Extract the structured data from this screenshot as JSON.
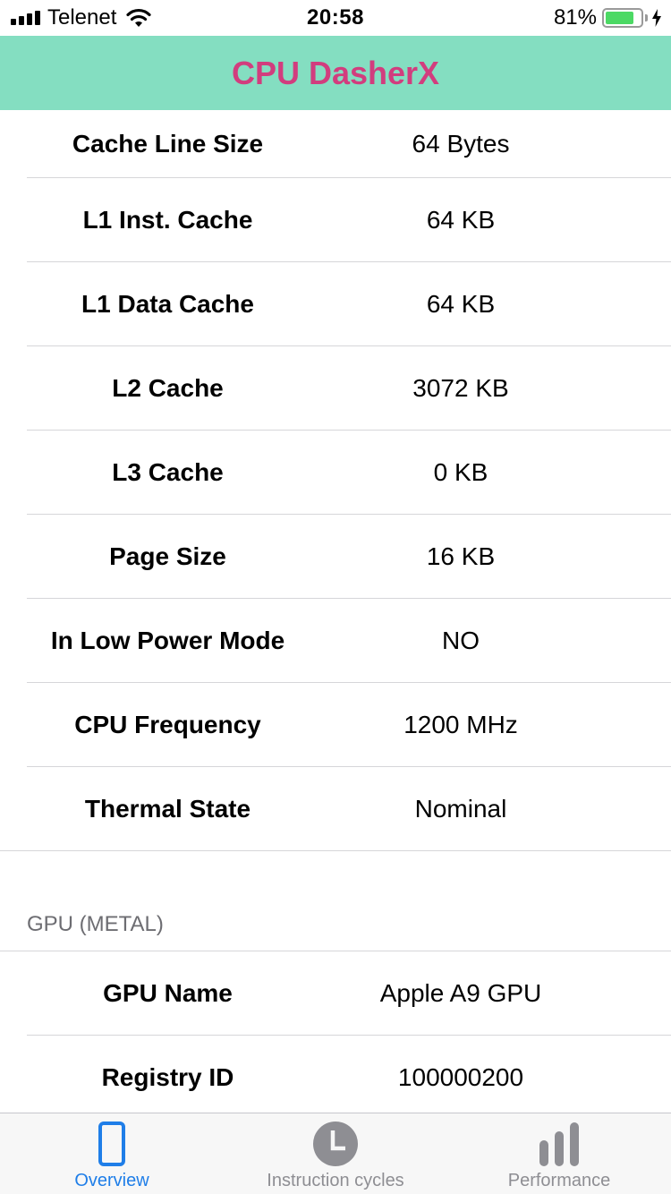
{
  "status_bar": {
    "carrier": "Telenet",
    "time": "20:58",
    "battery_percent": "81%",
    "battery_level": 0.81,
    "battery_color": "#4cd964"
  },
  "nav": {
    "title": "CPU DasherX",
    "background_color": "#84dec1",
    "title_color": "#d23d7e"
  },
  "cpu_rows": [
    {
      "label": "Cache Line Size",
      "value": "64 Bytes"
    },
    {
      "label": "L1 Inst. Cache",
      "value": "64 KB"
    },
    {
      "label": "L1 Data Cache",
      "value": "64 KB"
    },
    {
      "label": "L2 Cache",
      "value": "3072 KB"
    },
    {
      "label": "L3 Cache",
      "value": "0 KB"
    },
    {
      "label": "Page Size",
      "value": "16 KB"
    },
    {
      "label": "In Low Power Mode",
      "value": "NO"
    },
    {
      "label": "CPU Frequency",
      "value": "1200 MHz"
    },
    {
      "label": "Thermal State",
      "value": "Nominal"
    }
  ],
  "gpu_section": {
    "header": "GPU (METAL)",
    "rows": [
      {
        "label": "GPU Name",
        "value": "Apple A9 GPU"
      },
      {
        "label": "Registry ID",
        "value": "100000200"
      }
    ]
  },
  "tab_bar": {
    "active_color": "#1f7ee8",
    "inactive_color": "#8e8e93",
    "tabs": [
      {
        "label": "Overview",
        "icon": "phone-icon",
        "active": true
      },
      {
        "label": "Instruction cycles",
        "icon": "clock-icon",
        "active": false
      },
      {
        "label": "Performance",
        "icon": "bar-chart-icon",
        "active": false
      }
    ]
  }
}
